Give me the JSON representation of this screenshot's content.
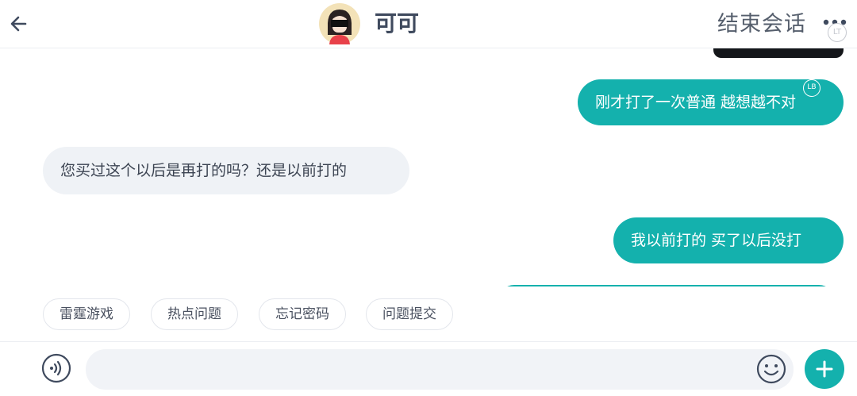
{
  "header": {
    "contact_name": "可可",
    "end_session_label": "结束会话",
    "lt_badge": "LT"
  },
  "messages": [
    {
      "side": "out",
      "text": "刚才打了一次普通 越想越不对",
      "badge": "LB"
    },
    {
      "side": "in",
      "text": "您买过这个以后是再打的吗？还是以前打的"
    },
    {
      "side": "out",
      "text": "我以前打的 买了以后没打"
    }
  ],
  "quick_replies": [
    "雷霆游戏",
    "热点问题",
    "忘记密码",
    "问题提交"
  ],
  "input": {
    "placeholder": ""
  },
  "colors": {
    "accent": "#14b1ad",
    "incoming_bubble": "#eff2f6",
    "header_text": "#3f4a5e"
  },
  "icons": {
    "back": "arrow-left-icon",
    "more": "more-dots-icon",
    "voice": "voice-icon",
    "emoji": "emoji-icon",
    "plus": "plus-icon"
  }
}
